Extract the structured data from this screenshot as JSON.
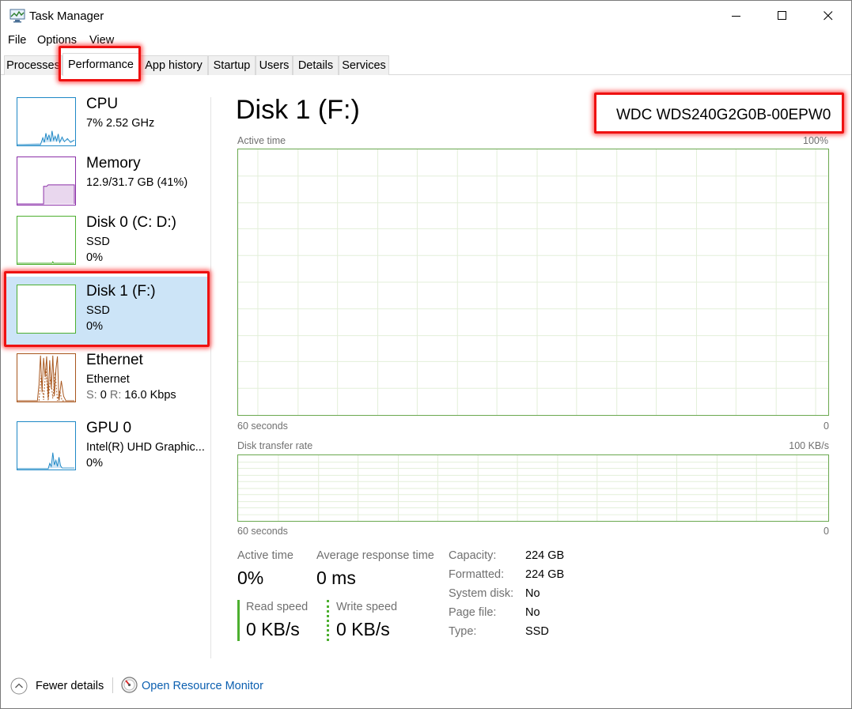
{
  "window": {
    "title": "Task Manager"
  },
  "menu": [
    "File",
    "Options",
    "View"
  ],
  "tabs": [
    "Processes",
    "Performance",
    "App history",
    "Startup",
    "Users",
    "Details",
    "Services"
  ],
  "active_tab": "Performance",
  "sidebar": {
    "items": [
      {
        "title": "CPU",
        "line1": "7%  2.52 GHz",
        "line2": ""
      },
      {
        "title": "Memory",
        "line1": "12.9/31.7 GB (41%)",
        "line2": ""
      },
      {
        "title": "Disk 0 (C: D:)",
        "line1": "SSD",
        "line2": "0%"
      },
      {
        "title": "Disk 1 (F:)",
        "line1": "SSD",
        "line2": "0%"
      },
      {
        "title": "Ethernet",
        "line1": "Ethernet",
        "line2_s_label": "S:",
        "line2_s_value": "0",
        "line2_r_label": "R:",
        "line2_r_value": "16.0 Kbps"
      },
      {
        "title": "GPU 0",
        "line1": "Intel(R) UHD Graphic...",
        "line2": "0%"
      }
    ],
    "selected": "Disk 1 (F:)"
  },
  "main": {
    "title": "Disk 1 (F:)",
    "device_name": "WDC WDS240G2G0B-00EPW0",
    "active_time_graph": {
      "label": "Active time",
      "max": "100%",
      "time_label": "60 seconds",
      "min": "0"
    },
    "transfer_graph": {
      "label": "Disk transfer rate",
      "max": "100 KB/s",
      "time_label": "60 seconds",
      "min": "0"
    },
    "stats": {
      "active_time_label": "Active time",
      "active_time_value": "0%",
      "avg_response_label": "Average response time",
      "avg_response_value": "0 ms",
      "read_speed_label": "Read speed",
      "read_speed_value": "0 KB/s",
      "write_speed_label": "Write speed",
      "write_speed_value": "0 KB/s"
    },
    "properties": [
      {
        "label": "Capacity:",
        "value": "224 GB"
      },
      {
        "label": "Formatted:",
        "value": "224 GB"
      },
      {
        "label": "System disk:",
        "value": "No"
      },
      {
        "label": "Page file:",
        "value": "No"
      },
      {
        "label": "Type:",
        "value": "SSD"
      }
    ]
  },
  "footer": {
    "fewer_details": "Fewer details",
    "open_resource_monitor": "Open Resource Monitor"
  },
  "colors": {
    "cpu": "#1e88c6",
    "memory": "#8b2fa8",
    "disk": "#4caf2f",
    "ethernet": "#a8561d",
    "gpu": "#1e88c6",
    "highlight": "#ee1111",
    "selected_bg": "#cce4f7"
  }
}
